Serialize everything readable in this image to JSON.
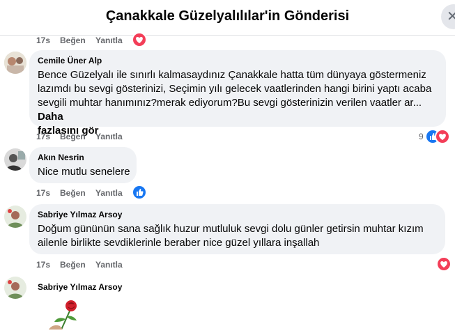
{
  "header": {
    "title": "Çanakkale Güzelyalılılar'in Gönderisi",
    "close_symbol": "✕"
  },
  "actions": {
    "time": "17s",
    "like": "Beğen",
    "reply": "Yanıtla"
  },
  "comments": [
    {
      "author": "Cemile Üner Alp",
      "lines": [
        "Bence Güzelyalı ile sınırlı kalmasaydınız Çanakkale hatta tüm dünyaya göstermeniz",
        "lazımdı bu sevgi gösterinizi, Seçimin yılı gelecek vaatlerinden hangi birini yaptı acaba",
        "sevgili muhtar hanımınız?merak ediyorum?Bu sevgi gösterinizin verilen vaatler ar..."
      ],
      "see_more_1": "Daha",
      "see_more_2": "fazlasını gör",
      "reaction_count": "9",
      "reactions": [
        "like-icon",
        "heart-icon"
      ]
    },
    {
      "author": "Akın Nesrin",
      "lines": [
        "Nice mutlu senelere"
      ],
      "reactions": [
        "like-icon"
      ]
    },
    {
      "author": "Sabriye Yılmaz Arsoy",
      "lines": [
        "Doğum gününün sana sağlık huzur mutluluk sevgi dolu günler getirsin muhtar kızım",
        "ailenle birlikte sevdiklerinle beraber nice güzel yıllara inşallah"
      ],
      "reactions": [
        "heart-icon"
      ]
    },
    {
      "author": "Sabriye Yılmaz Arsoy",
      "sticker": "rose-sticker"
    }
  ],
  "colors": {
    "like": "#1877f2",
    "heart": "#f33e58",
    "bubble": "#f0f2f5",
    "meta": "#65676b"
  }
}
